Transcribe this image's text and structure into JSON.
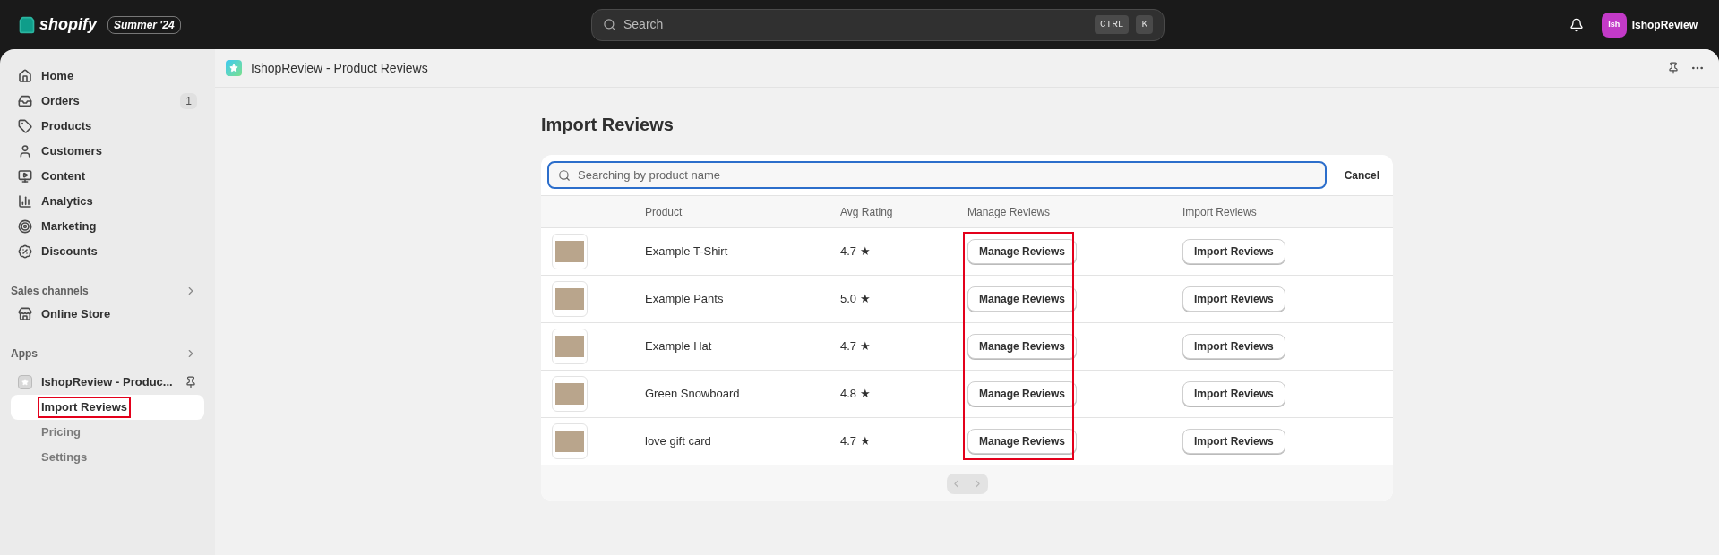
{
  "topbar": {
    "logo": "shopify",
    "edition_badge": "Summer '24",
    "search": {
      "placeholder": "Search",
      "shortcut": [
        "CTRL",
        "K"
      ]
    },
    "account": {
      "initials": "Ish",
      "name": "IshopReview"
    }
  },
  "sidebar": {
    "items": [
      {
        "label": "Home",
        "selected": false
      },
      {
        "label": "Orders",
        "selected": false,
        "badge": "1"
      },
      {
        "label": "Products",
        "selected": false
      },
      {
        "label": "Customers",
        "selected": false
      },
      {
        "label": "Content",
        "selected": false
      },
      {
        "label": "Analytics",
        "selected": false
      },
      {
        "label": "Marketing",
        "selected": false
      },
      {
        "label": "Discounts",
        "selected": false
      }
    ],
    "sales_channels": {
      "heading": "Sales channels",
      "items": [
        {
          "label": "Online Store",
          "selected": false
        }
      ]
    },
    "apps": {
      "heading": "Apps",
      "app": {
        "label": "IshopReview - Produc...",
        "children": [
          {
            "label": "Import Reviews",
            "selected": true,
            "highlighted": true
          },
          {
            "label": "Pricing",
            "selected": false,
            "highlighted": false
          },
          {
            "label": "Settings",
            "selected": false,
            "highlighted": false
          }
        ]
      }
    }
  },
  "app_header": {
    "title": "IshopReview - Product Reviews"
  },
  "page": {
    "title": "Import Reviews",
    "search": {
      "placeholder": "Searching by product name",
      "cancel": "Cancel"
    },
    "table": {
      "columns": [
        {
          "label": "Product",
          "highlighted": false
        },
        {
          "label": "Avg Rating",
          "highlighted": false
        },
        {
          "label": "Manage Reviews",
          "highlighted": true
        },
        {
          "label": "Import Reviews",
          "highlighted": false
        }
      ],
      "rows": [
        {
          "product": "Example T-Shirt",
          "rating": "4.7 ★",
          "manage": "Manage Reviews",
          "import": "Import Reviews"
        },
        {
          "product": "Example Pants",
          "rating": "5.0 ★",
          "manage": "Manage Reviews",
          "import": "Import Reviews"
        },
        {
          "product": "Example Hat",
          "rating": "4.7 ★",
          "manage": "Manage Reviews",
          "import": "Import Reviews"
        },
        {
          "product": "Green Snowboard",
          "rating": "4.8 ★",
          "manage": "Manage Reviews",
          "import": "Import Reviews"
        },
        {
          "product": "love gift card",
          "rating": "4.7 ★",
          "manage": "Manage Reviews",
          "import": "Import Reviews"
        }
      ]
    },
    "pagination": {
      "previous_disabled": true,
      "next_disabled": true
    }
  }
}
